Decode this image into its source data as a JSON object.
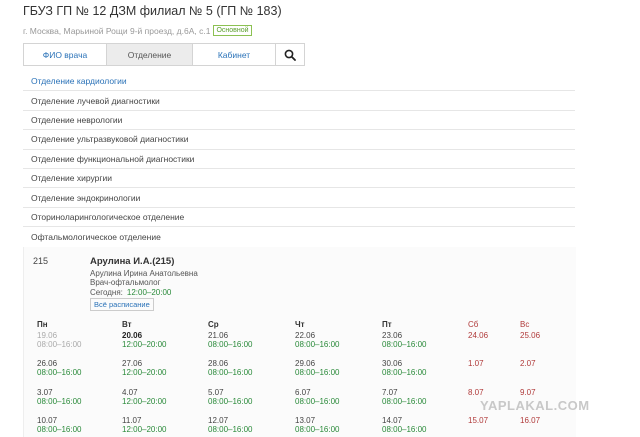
{
  "header": {
    "title": "ГБУЗ ГП № 12 ДЗМ филиал № 5 (ГП № 183)",
    "address": "г. Москва, Марьиной Рощи 9-й проезд, д.6А, с.1",
    "badge": "Основной"
  },
  "tabs": [
    {
      "label": "ФИО врача",
      "active": false
    },
    {
      "label": "Отделение",
      "active": true
    },
    {
      "label": "Кабинет",
      "active": false
    }
  ],
  "departments": [
    "Отделение кардиологии",
    "Отделение лучевой диагностики",
    "Отделение неврологии",
    "Отделение ультразвуковой диагностики",
    "Отделение функциональной диагностики",
    "Отделение хирургии",
    "Отделение эндокринологии",
    "Оториноларингологическое отделение",
    "Офтальмологическое отделение"
  ],
  "doctor": {
    "room": "215",
    "short_name": "Арулина И.А.(215)",
    "full_name": "Арулина Ирина Анатольевна",
    "role": "Врач-офтальмолог",
    "today_label": "Сегодня:",
    "today_hours": "12:00–20:00",
    "all_schedule": "Всё расписание"
  },
  "schedule": {
    "days": [
      "Пн",
      "Вт",
      "Ср",
      "Чт",
      "Пт",
      "Сб",
      "Вс"
    ],
    "weeks": [
      [
        {
          "date": "19.06",
          "time": "08:00–16:00",
          "state": "past"
        },
        {
          "date": "20.06",
          "time": "12:00–20:00",
          "state": "today"
        },
        {
          "date": "21.06",
          "time": "08:00–16:00",
          "state": "normal"
        },
        {
          "date": "22.06",
          "time": "08:00–16:00",
          "state": "normal"
        },
        {
          "date": "23.06",
          "time": "08:00–16:00",
          "state": "normal"
        },
        {
          "date": "24.06",
          "time": "",
          "state": "weekend"
        },
        {
          "date": "25.06",
          "time": "",
          "state": "weekend"
        }
      ],
      [
        {
          "date": "26.06",
          "time": "08:00–16:00",
          "state": "normal"
        },
        {
          "date": "27.06",
          "time": "12:00–20:00",
          "state": "normal"
        },
        {
          "date": "28.06",
          "time": "08:00–16:00",
          "state": "normal"
        },
        {
          "date": "29.06",
          "time": "08:00–16:00",
          "state": "normal"
        },
        {
          "date": "30.06",
          "time": "08:00–16:00",
          "state": "normal"
        },
        {
          "date": "1.07",
          "time": "",
          "state": "weekend"
        },
        {
          "date": "2.07",
          "time": "",
          "state": "weekend"
        }
      ],
      [
        {
          "date": "3.07",
          "time": "08:00–16:00",
          "state": "normal"
        },
        {
          "date": "4.07",
          "time": "12:00–20:00",
          "state": "normal"
        },
        {
          "date": "5.07",
          "time": "08:00–16:00",
          "state": "normal"
        },
        {
          "date": "6.07",
          "time": "08:00–16:00",
          "state": "normal"
        },
        {
          "date": "7.07",
          "time": "08:00–16:00",
          "state": "normal"
        },
        {
          "date": "8.07",
          "time": "",
          "state": "weekend"
        },
        {
          "date": "9.07",
          "time": "",
          "state": "weekend"
        }
      ],
      [
        {
          "date": "10.07",
          "time": "08:00–16:00",
          "state": "normal"
        },
        {
          "date": "11.07",
          "time": "12:00–20:00",
          "state": "normal"
        },
        {
          "date": "12.07",
          "time": "08:00–16:00",
          "state": "normal"
        },
        {
          "date": "13.07",
          "time": "08:00–16:00",
          "state": "normal"
        },
        {
          "date": "14.07",
          "time": "08:00–16:00",
          "state": "normal"
        },
        {
          "date": "15.07",
          "time": "",
          "state": "weekend"
        },
        {
          "date": "16.07",
          "time": "",
          "state": "weekend"
        }
      ]
    ]
  },
  "watermark": "YAPLAKAL.COM",
  "colors": {
    "link": "#2a72b8",
    "hours": "#2a8a3a",
    "weekend": "#b03a3a",
    "badge": "#5a9e2b"
  },
  "icons": {
    "search": "search-icon"
  }
}
